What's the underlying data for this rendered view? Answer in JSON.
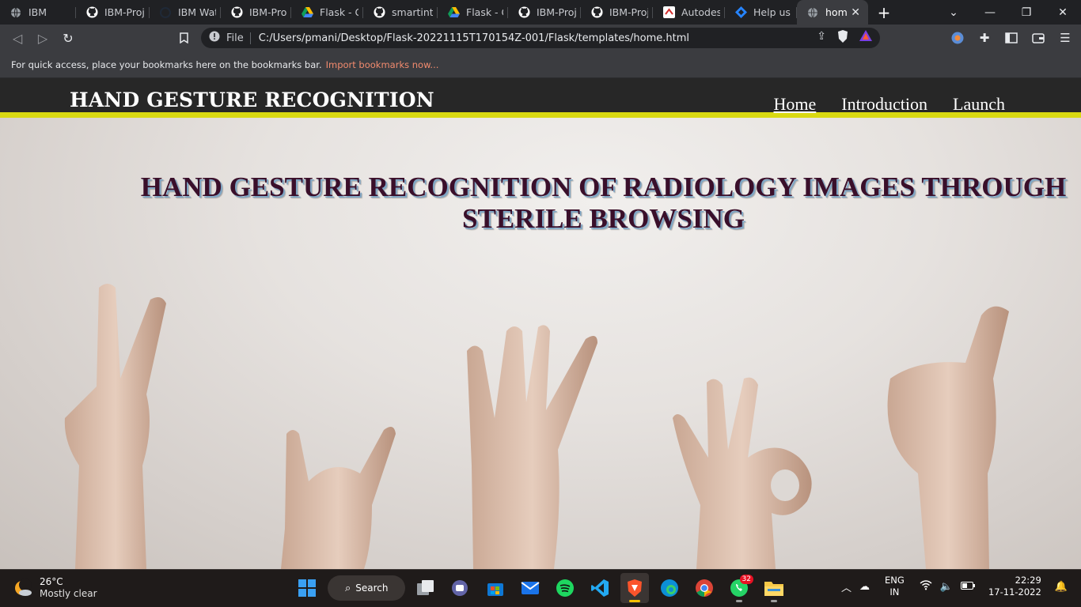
{
  "browser": {
    "tabs": [
      {
        "title": "IBM",
        "icon": "globe-icon"
      },
      {
        "title": "IBM-Proje",
        "icon": "github-icon"
      },
      {
        "title": "IBM Watso",
        "icon": "ibm-watson-icon"
      },
      {
        "title": "IBM-Proje",
        "icon": "github-icon"
      },
      {
        "title": "Flask - Go",
        "icon": "google-drive-icon"
      },
      {
        "title": "smartinter",
        "icon": "github-icon"
      },
      {
        "title": "Flask - Go",
        "icon": "google-drive-icon"
      },
      {
        "title": "IBM-Proje",
        "icon": "github-icon"
      },
      {
        "title": "IBM-Proje",
        "icon": "github-icon"
      },
      {
        "title": "Autodesk",
        "icon": "autodesk-icon"
      },
      {
        "title": "Help us se",
        "icon": "jira-icon"
      },
      {
        "title": "home.",
        "icon": "globe-icon",
        "active": true
      }
    ],
    "new_tab": "+",
    "address": {
      "scheme_label": "File",
      "url": "C:/Users/pmani/Desktop/Flask-20221115T170154Z-001/Flask/templates/home.html"
    },
    "bookmarks_bar": {
      "message": "For quick access, place your bookmarks here on the bookmarks bar.",
      "import_link": "Import bookmarks now..."
    }
  },
  "site": {
    "brand": "HAND GESTURE RECOGNITION",
    "nav": [
      {
        "label": "Home",
        "current": true
      },
      {
        "label": "Introduction"
      },
      {
        "label": "Launch"
      }
    ],
    "hero_title": "HAND GESTURE RECOGNITION OF RADIOLOGY IMAGES THROUGH STERILE BROWSING",
    "accent_color": "#d9d912",
    "header_color": "#272727",
    "title_color": "#3a0f2a"
  },
  "taskbar": {
    "weather": {
      "temp": "26°C",
      "condition": "Mostly clear"
    },
    "search_label": "Search",
    "apps": [
      "windows-start-icon",
      "task-view-icon",
      "teams-chat-icon",
      "microsoft-store-icon",
      "mail-icon",
      "spotify-icon",
      "vscode-icon",
      "brave-icon",
      "edge-icon",
      "chrome-icon",
      "whatsapp-icon",
      "file-explorer-icon"
    ],
    "whatsapp_badge": "32",
    "language": {
      "line1": "ENG",
      "line2": "IN"
    },
    "clock": {
      "time": "22:29",
      "date": "17-11-2022"
    }
  }
}
